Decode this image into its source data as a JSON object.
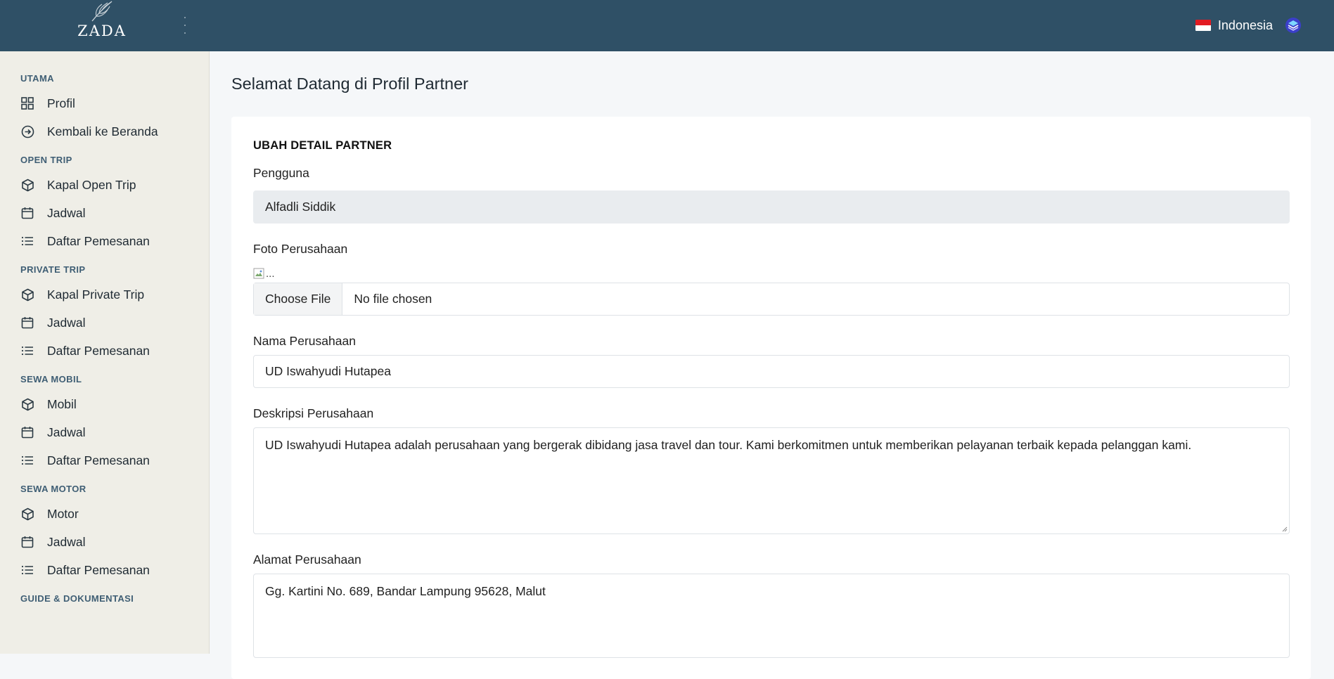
{
  "brand": {
    "name": "ZADA"
  },
  "topbar": {
    "language": "Indonesia"
  },
  "sidebar": {
    "sections": [
      {
        "title": "UTAMA",
        "items": [
          {
            "label": "Profil",
            "icon": "grid-icon"
          },
          {
            "label": "Kembali ke Beranda",
            "icon": "arrow-circle-icon"
          }
        ]
      },
      {
        "title": "OPEN TRIP",
        "items": [
          {
            "label": "Kapal Open Trip",
            "icon": "box-icon"
          },
          {
            "label": "Jadwal",
            "icon": "calendar-icon"
          },
          {
            "label": "Daftar Pemesanan",
            "icon": "list-icon"
          }
        ]
      },
      {
        "title": "PRIVATE TRIP",
        "items": [
          {
            "label": "Kapal Private Trip",
            "icon": "box-icon"
          },
          {
            "label": "Jadwal",
            "icon": "calendar-icon"
          },
          {
            "label": "Daftar Pemesanan",
            "icon": "list-icon"
          }
        ]
      },
      {
        "title": "SEWA MOBIL",
        "items": [
          {
            "label": "Mobil",
            "icon": "box-icon"
          },
          {
            "label": "Jadwal",
            "icon": "calendar-icon"
          },
          {
            "label": "Daftar Pemesanan",
            "icon": "list-icon"
          }
        ]
      },
      {
        "title": "SEWA MOTOR",
        "items": [
          {
            "label": "Motor",
            "icon": "box-icon"
          },
          {
            "label": "Jadwal",
            "icon": "calendar-icon"
          },
          {
            "label": "Daftar Pemesanan",
            "icon": "list-icon"
          }
        ]
      },
      {
        "title": "GUIDE & DOKUMENTASI",
        "items": []
      }
    ]
  },
  "main": {
    "page_title": "Selamat Datang di Profil Partner",
    "card_title": "UBAH DETAIL PARTNER",
    "user": {
      "label": "Pengguna",
      "value": "Alfadli Siddik"
    },
    "photo": {
      "label": "Foto Perusahaan",
      "broken_image_alt": "...",
      "choose_button": "Choose File",
      "file_status": "No file chosen"
    },
    "company_name": {
      "label": "Nama Perusahaan",
      "value": "UD Iswahyudi Hutapea"
    },
    "company_description": {
      "label": "Deskripsi Perusahaan",
      "value": "UD Iswahyudi Hutapea adalah perusahaan yang bergerak dibidang jasa travel dan tour. Kami berkomitmen untuk memberikan pelayanan terbaik kepada pelanggan kami."
    },
    "company_address": {
      "label": "Alamat Perusahaan",
      "value": "Gg. Kartini No. 689, Bandar Lampung 95628, Malut"
    }
  },
  "colors": {
    "topbar": "#2f5066",
    "sidebar": "#efeee7",
    "section_title": "#3f5e74",
    "background": "#f5f7f9"
  }
}
